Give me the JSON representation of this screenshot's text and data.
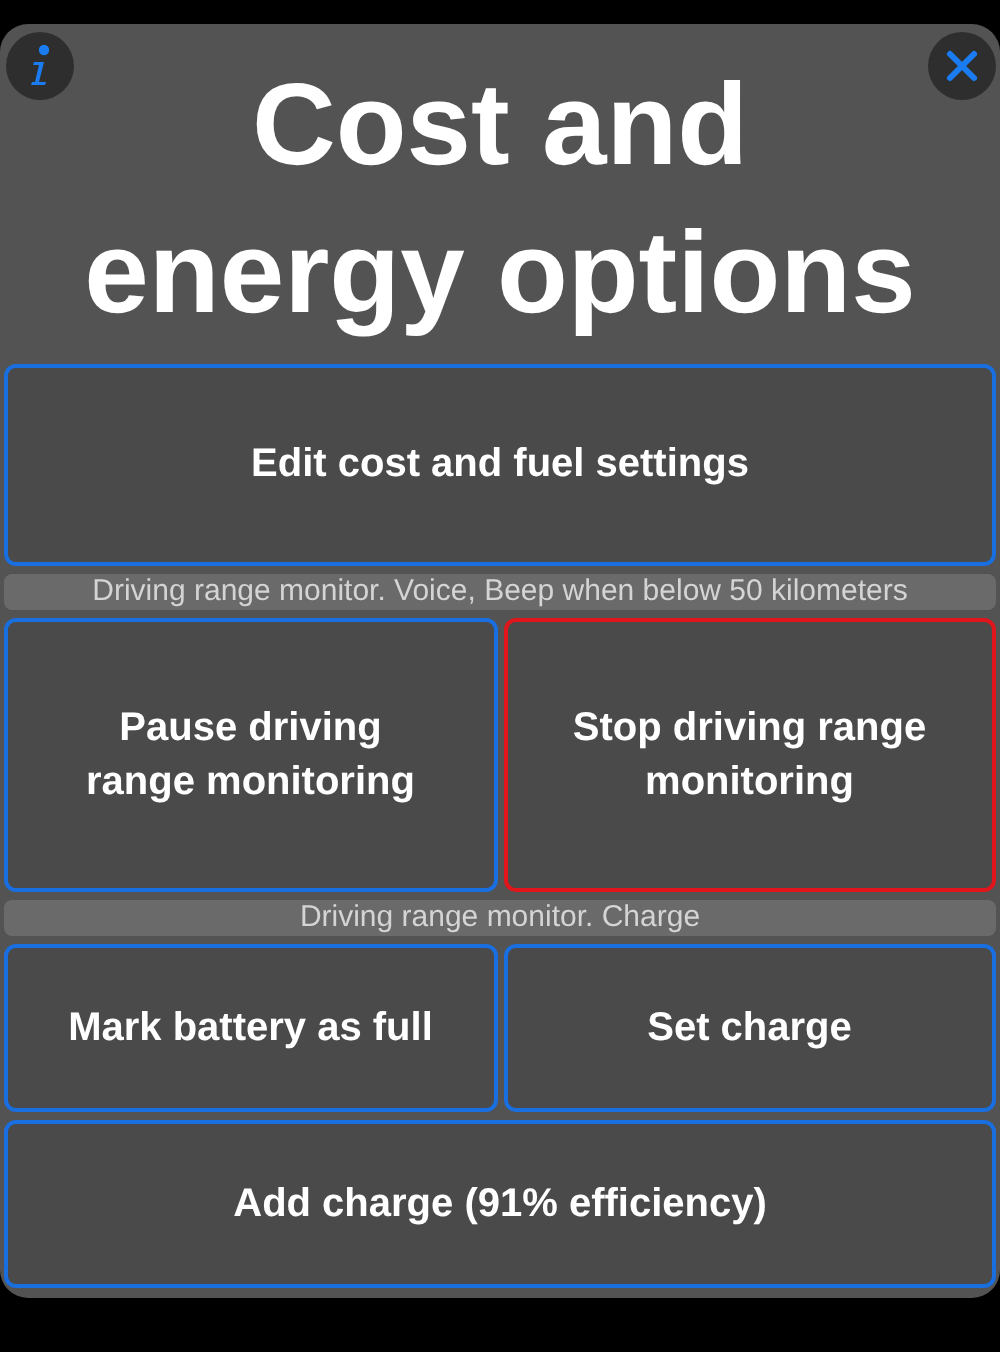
{
  "title": "Cost and energy options",
  "rows": [
    {
      "kind": "buttons",
      "buttons": [
        {
          "label": "Edit cost and fuel settings",
          "kind": "normal"
        }
      ]
    },
    {
      "kind": "label",
      "text": "Driving range monitor. Voice, Beep when below 50 kilometers"
    },
    {
      "kind": "buttons",
      "buttons": [
        {
          "label": "Pause driving range monitoring",
          "kind": "normal"
        },
        {
          "label": "Stop driving range monitoring",
          "kind": "destructive"
        }
      ]
    },
    {
      "kind": "label",
      "text": "Driving range monitor. Charge"
    },
    {
      "kind": "buttons",
      "buttons": [
        {
          "label": "Mark battery as full",
          "kind": "normal"
        },
        {
          "label": "Set charge",
          "kind": "normal"
        }
      ]
    },
    {
      "kind": "buttons",
      "buttons": [
        {
          "label": "Add charge (91% efficiency)",
          "kind": "normal"
        }
      ]
    }
  ]
}
